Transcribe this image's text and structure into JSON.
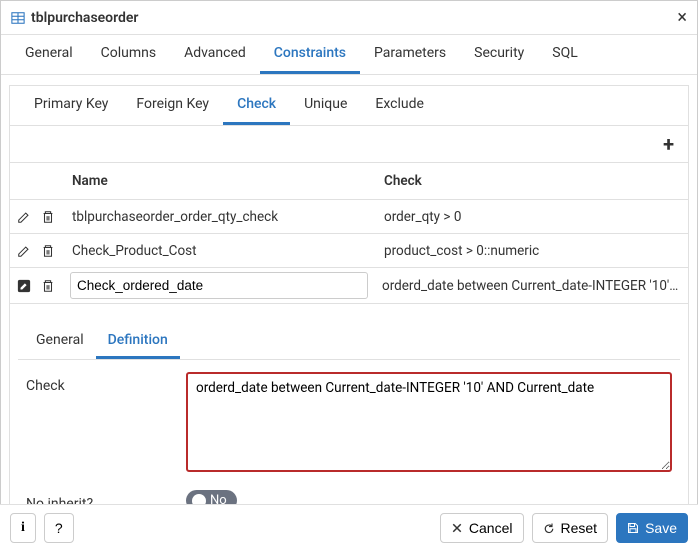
{
  "header": {
    "title": "tblpurchaseorder"
  },
  "top_tabs": {
    "general": "General",
    "columns": "Columns",
    "advanced": "Advanced",
    "constraints": "Constraints",
    "parameters": "Parameters",
    "security": "Security",
    "sql": "SQL"
  },
  "sub_tabs": {
    "primary_key": "Primary Key",
    "foreign_key": "Foreign Key",
    "check": "Check",
    "unique": "Unique",
    "exclude": "Exclude"
  },
  "grid": {
    "columns": {
      "name": "Name",
      "check": "Check"
    },
    "rows": [
      {
        "name": "tblpurchaseorder_order_qty_check",
        "check": "order_qty > 0"
      },
      {
        "name": "Check_Product_Cost",
        "check": "product_cost > 0::numeric"
      },
      {
        "name": "Check_ordered_date",
        "check": "orderd_date between Current_date-INTEGER '10' ..."
      }
    ]
  },
  "detail_tabs": {
    "general": "General",
    "definition": "Definition"
  },
  "form": {
    "check_label": "Check",
    "check_value": "orderd_date between Current_date-INTEGER '10' AND Current_date",
    "no_inherit_label": "No inherit?",
    "no_inherit_value": "No"
  },
  "footer": {
    "info": "i",
    "help": "?",
    "cancel": "Cancel",
    "reset": "Reset",
    "save": "Save"
  }
}
